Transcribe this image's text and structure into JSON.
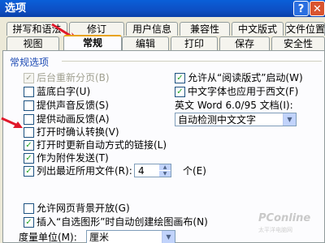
{
  "window": {
    "title": "选项",
    "help": "?",
    "close": "✕"
  },
  "tabs_row1": [
    "拼写和语法",
    "修订",
    "用户信息",
    "兼容性",
    "中文版式",
    "文件位置"
  ],
  "tabs_row2": [
    "视图",
    "常规",
    "编辑",
    "打印",
    "保存",
    "安全性"
  ],
  "group": {
    "label": "常规选项"
  },
  "left_options": [
    {
      "label": "后台重新分页(B)",
      "checked": true,
      "disabled": true
    },
    {
      "label": "蓝底白字(U)",
      "checked": false
    },
    {
      "label": "提供声音反馈(S)",
      "checked": false
    },
    {
      "label": "提供动画反馈(A)",
      "checked": false
    },
    {
      "label": "打开时确认转换(V)",
      "checked": false
    },
    {
      "label": "打开时更新自动方式的链接(L)",
      "checked": true
    },
    {
      "label": "作为附件发送(T)",
      "checked": true
    },
    {
      "label": "列出最近所用文件(R):",
      "checked": true
    }
  ],
  "right_options": [
    {
      "label": "允许从“阅读版式”启动(W)",
      "checked": true
    },
    {
      "label": "中文字体也应用于西文(F)",
      "checked": true
    }
  ],
  "doc_label": "英文 Word 6.0/95 文档(I):",
  "doc_select": "自动检测中文文字",
  "recent_count": "4",
  "recent_unit": "个(E)",
  "bottom_options": [
    {
      "label": "允许网页背景开放(G)",
      "checked": false
    },
    {
      "label": "插入“自选图形”时自动创建绘图画布(N)",
      "checked": true
    }
  ],
  "unit_label": "度量单位(M):",
  "unit_select": "厘米",
  "watermark": "PConline",
  "watermark_sub": "太平洋电脑网",
  "accent": "#e8a317",
  "pointer_color": "#e0182a"
}
